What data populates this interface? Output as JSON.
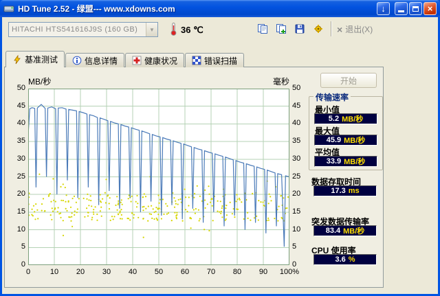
{
  "window": {
    "title": "HD Tune 2.52 - 绿盟--- www.xdowns.com",
    "download_glyph": "↓",
    "close_glyph": "×"
  },
  "toolbar": {
    "drive": "HITACHI HTS541616J9S (160 GB)",
    "combo_arrow": "▼",
    "temperature": "36 ℃",
    "exit_x": "×",
    "exit": "退出(X)"
  },
  "tabs": [
    {
      "label": "基准测试",
      "active": true
    },
    {
      "label": "信息详情",
      "active": false
    },
    {
      "label": "健康状况",
      "active": false
    },
    {
      "label": "错误扫描",
      "active": false
    }
  ],
  "panel": {
    "start_button": "开始",
    "results": {
      "group_title": "传输速率",
      "items": [
        {
          "label": "最小值",
          "num": "5.2",
          "unit": "MB/秒"
        },
        {
          "label": "最大值",
          "num": "45.9",
          "unit": "MB/秒"
        },
        {
          "label": "平均值",
          "num": "33.9",
          "unit": "MB/秒"
        },
        {
          "label": "数据存取时间",
          "num": "17.3",
          "unit": "ms"
        },
        {
          "label": "突发数据传输率",
          "num": "83.4",
          "unit": "MB/秒"
        },
        {
          "label": "CPU 使用率",
          "num": "3.6",
          "unit": "%"
        }
      ]
    }
  },
  "chart_data": {
    "type": "line+scatter",
    "y_left_label": "MB/秒",
    "y_right_label": "毫秒",
    "y_max": 50,
    "y_ticks": [
      "50",
      "45",
      "40",
      "35",
      "30",
      "25",
      "20",
      "15",
      "10",
      "5",
      "0"
    ],
    "x_ticks": [
      "0",
      "10",
      "20",
      "30",
      "40",
      "50",
      "60",
      "70",
      "80",
      "90",
      "100%"
    ],
    "grid_on": true,
    "grid_color": "#b5d2b5",
    "border_color": "#7ca07c",
    "line_color": "#4a7ab8",
    "dot_color": "#d6d600",
    "summary": {
      "min_mb_s": 5.2,
      "max_mb_s": 45.9,
      "avg_mb_s": 33.9,
      "access_time_ms": 17.3,
      "burst_mb_s": 83.4,
      "cpu_pct": 3.6
    },
    "transfer_line_points": [
      [
        0,
        37
      ],
      [
        0.6,
        44.3
      ],
      [
        1.5,
        44.6
      ],
      [
        2.5,
        44.4
      ],
      [
        3,
        22
      ],
      [
        3.5,
        44.5
      ],
      [
        5,
        45.5
      ],
      [
        6.5,
        44.4
      ],
      [
        7,
        25
      ],
      [
        7.5,
        44.5
      ],
      [
        9,
        44.8
      ],
      [
        10.5,
        44.3
      ],
      [
        11,
        20
      ],
      [
        11.5,
        44.5
      ],
      [
        13,
        44.6
      ],
      [
        14.5,
        44.2
      ],
      [
        15,
        24
      ],
      [
        15.5,
        44.1
      ],
      [
        17,
        43.9
      ],
      [
        18.5,
        43.7
      ],
      [
        19,
        19
      ],
      [
        19.5,
        43.5
      ],
      [
        21,
        43.2
      ],
      [
        22.5,
        42.8
      ],
      [
        23,
        22
      ],
      [
        23.5,
        42.6
      ],
      [
        25,
        42.3
      ],
      [
        26.5,
        41.8
      ],
      [
        27,
        17
      ],
      [
        27.5,
        41.7
      ],
      [
        29,
        41.3
      ],
      [
        30.5,
        40.9
      ],
      [
        31,
        21
      ],
      [
        31.5,
        40.7
      ],
      [
        33,
        40.3
      ],
      [
        34.5,
        40
      ],
      [
        35,
        16
      ],
      [
        35.5,
        39.8
      ],
      [
        37,
        39.4
      ],
      [
        38.5,
        39.1
      ],
      [
        39,
        19
      ],
      [
        39.5,
        38.9
      ],
      [
        41,
        38.5
      ],
      [
        42.5,
        38.2
      ],
      [
        43,
        15
      ],
      [
        43.5,
        38
      ],
      [
        45,
        37.6
      ],
      [
        46.5,
        37.2
      ],
      [
        47,
        18
      ],
      [
        47.5,
        37
      ],
      [
        49,
        36.6
      ],
      [
        50.5,
        36.3
      ],
      [
        51,
        14
      ],
      [
        51.5,
        36.1
      ],
      [
        53,
        35.7
      ],
      [
        54.5,
        35.4
      ],
      [
        55,
        17
      ],
      [
        55.5,
        35.2
      ],
      [
        57,
        34.8
      ],
      [
        58.5,
        34.5
      ],
      [
        59,
        13
      ],
      [
        59.5,
        34.3
      ],
      [
        61,
        33.9
      ],
      [
        62.5,
        33.5
      ],
      [
        63,
        16
      ],
      [
        63.5,
        33.3
      ],
      [
        65,
        32.9
      ],
      [
        66.5,
        32.6
      ],
      [
        67,
        12
      ],
      [
        67.5,
        32.4
      ],
      [
        69,
        32
      ],
      [
        70.5,
        31.7
      ],
      [
        71,
        15
      ],
      [
        71.5,
        31.5
      ],
      [
        73,
        31.1
      ],
      [
        74.5,
        30.8
      ],
      [
        75,
        11
      ],
      [
        75.5,
        30.6
      ],
      [
        77,
        30.2
      ],
      [
        78.5,
        29.8
      ],
      [
        79,
        14
      ],
      [
        79.5,
        29.6
      ],
      [
        81,
        29.2
      ],
      [
        82.5,
        28.9
      ],
      [
        83,
        10
      ],
      [
        83.5,
        28.7
      ],
      [
        85,
        28.3
      ],
      [
        86.5,
        28
      ],
      [
        87,
        12
      ],
      [
        87.5,
        27.8
      ],
      [
        89,
        27.4
      ],
      [
        90.5,
        27.1
      ],
      [
        91,
        9
      ],
      [
        91.5,
        26.9
      ],
      [
        93,
        26.5
      ],
      [
        94.5,
        26.1
      ],
      [
        95,
        11
      ],
      [
        95.5,
        25.9
      ],
      [
        97,
        25.6
      ],
      [
        98,
        5.2
      ],
      [
        98.5,
        25.3
      ],
      [
        99.5,
        25.1
      ],
      [
        100,
        25
      ]
    ],
    "access_scatter": {
      "seed": 7,
      "count": 320,
      "y_min": 12.5,
      "y_max": 20.5,
      "outlier_every": 9,
      "outlier_extra": 7,
      "dot_radius": 1.1
    }
  }
}
